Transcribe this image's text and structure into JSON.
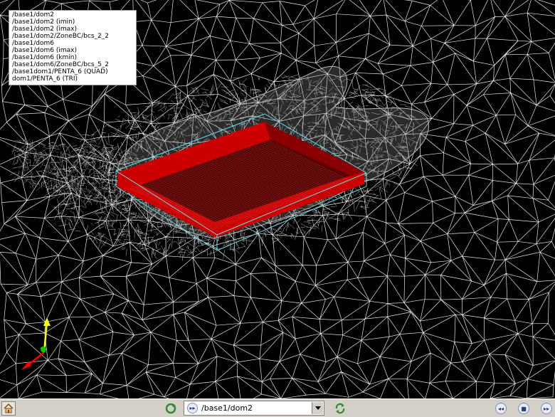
{
  "legend": {
    "lines": [
      "/base1/dom2",
      "/base1/dom2 (imin)",
      "/base1/dom2 (imax)",
      "/base1/dom2/ZoneBC/bcs_2_2",
      "/base1/dom6",
      "/base1/dom6 (imax)",
      "/base1/dom6 (kmin)",
      "/base1/dom6/ZoneBC/bcs_5_2",
      "/base1dom1/PENTA_6 (QUAD)",
      "dom1/PENTA_6 (TRI)"
    ]
  },
  "toolbar": {
    "selector_value": "/base1/dom2",
    "icons": {
      "home": "home-icon",
      "cycle": "cycle-icon",
      "selector": "next-icon",
      "refresh": "refresh-icon",
      "prev": "rewind-icon",
      "stop": "stop-icon",
      "next": "fast-forward-icon"
    }
  },
  "colors": {
    "background": "#000000",
    "mesh": "#ffffff",
    "highlight_block": "#cc0000",
    "block_outline": "#66e0e8",
    "toolbar": "#d4d0c8",
    "axis_x": "#ff0000",
    "axis_y": "#ffff00",
    "axis_z": "#00cc00"
  }
}
